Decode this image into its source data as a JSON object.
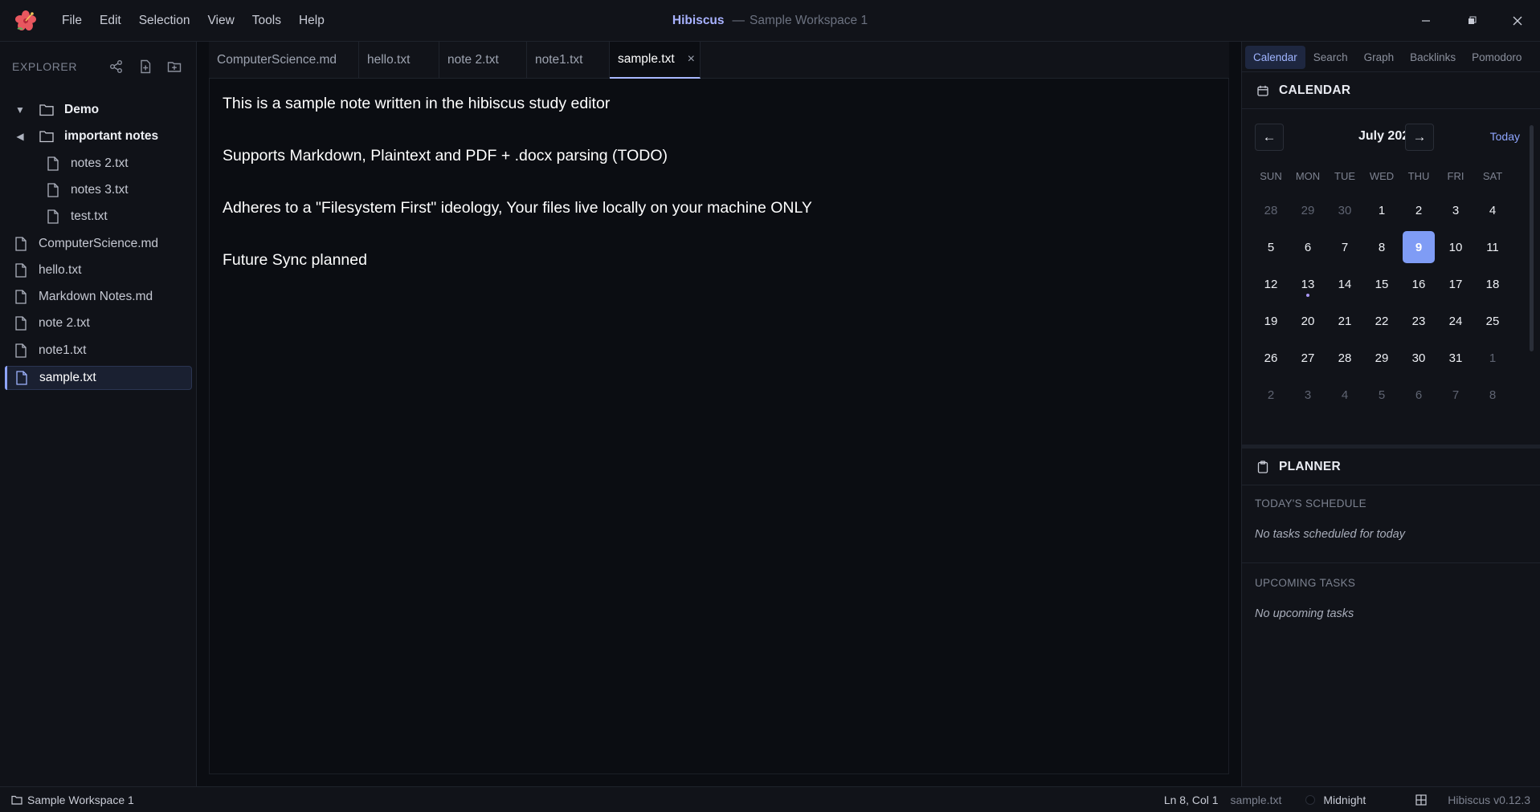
{
  "titlebar": {
    "app_name": "Hibiscus",
    "separator": "—",
    "workspace": "Sample Workspace 1",
    "menu": [
      "File",
      "Edit",
      "Selection",
      "View",
      "Tools",
      "Help"
    ],
    "window_controls": [
      "minimize-icon",
      "maximize-icon",
      "close-icon"
    ]
  },
  "explorer": {
    "title": "EXPLORER",
    "actions": [
      "graph-icon",
      "new-file-icon",
      "new-folder-icon"
    ],
    "tree": [
      {
        "label": "Demo",
        "type": "folder",
        "expanded": true,
        "depth": 0
      },
      {
        "label": "important notes",
        "type": "folder",
        "expanded": false,
        "depth": 0
      },
      {
        "label": "notes 2.txt",
        "type": "file",
        "depth": 1
      },
      {
        "label": "notes 3.txt",
        "type": "file",
        "depth": 1
      },
      {
        "label": "test.txt",
        "type": "file",
        "depth": 1
      },
      {
        "label": "ComputerScience.md",
        "type": "file",
        "depth": 0
      },
      {
        "label": "hello.txt",
        "type": "file",
        "depth": 0
      },
      {
        "label": "Markdown Notes.md",
        "type": "file",
        "depth": 0
      },
      {
        "label": "note 2.txt",
        "type": "file",
        "depth": 0
      },
      {
        "label": "note1.txt",
        "type": "file",
        "depth": 0
      },
      {
        "label": "sample.txt",
        "type": "file",
        "depth": 0,
        "active": true
      }
    ]
  },
  "editor": {
    "tabs": [
      {
        "label": "ComputerScience.md"
      },
      {
        "label": "hello.txt"
      },
      {
        "label": "note 2.txt"
      },
      {
        "label": "note1.txt"
      },
      {
        "label": "sample.txt",
        "active": true,
        "close": "×"
      }
    ],
    "lines": [
      "This is a sample note written in the hibiscus study editor",
      "Supports Markdown, Plaintext and PDF + .docx parsing (TODO)",
      "Adheres to a \"Filesystem First\" ideology, Your files live locally on your machine ONLY",
      "Future Sync planned"
    ]
  },
  "rightbar": {
    "tabs": [
      "Calendar",
      "Search",
      "Graph",
      "Backlinks",
      "Pomodoro"
    ],
    "active_tab": "Calendar",
    "calendar": {
      "title": "CALENDAR",
      "prev": "←",
      "next": "→",
      "month": "July 2026",
      "today_label": "Today",
      "weekdays": [
        "SUN",
        "MON",
        "TUE",
        "WED",
        "THU",
        "FRI",
        "SAT"
      ],
      "weeks": [
        [
          "28",
          "29",
          "30",
          "1",
          "2",
          "3",
          "4"
        ],
        [
          "5",
          "6",
          "7",
          "8",
          "9",
          "10",
          "11"
        ],
        [
          "12",
          "13",
          "14",
          "15",
          "16",
          "17",
          "18"
        ],
        [
          "19",
          "20",
          "21",
          "22",
          "23",
          "24",
          "25"
        ],
        [
          "26",
          "27",
          "28",
          "29",
          "30",
          "31",
          "1"
        ],
        [
          "2",
          "3",
          "4",
          "5",
          "6",
          "7",
          "8"
        ]
      ],
      "today": "9",
      "event_day": "13",
      "accent": "#7f9cf5"
    },
    "planner": {
      "title": "PLANNER",
      "schedule_label": "TODAY'S SCHEDULE",
      "schedule_empty": "No tasks scheduled for today",
      "upcoming_label": "UPCOMING TASKS",
      "upcoming_empty": "No upcoming tasks"
    }
  },
  "statusbar": {
    "workspace": "Sample Workspace 1",
    "position": "Ln 8, Col 1",
    "file": "sample.txt",
    "theme": "Midnight",
    "version": "Hibiscus v0.12.3"
  }
}
